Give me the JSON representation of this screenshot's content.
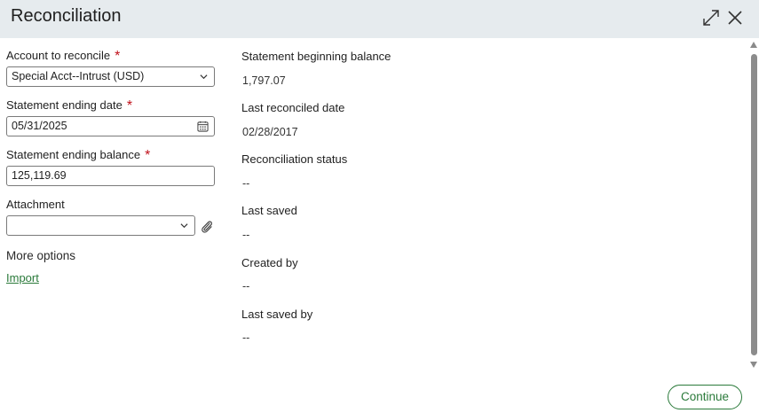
{
  "dialog": {
    "title": "Reconciliation",
    "icons": {
      "expand": "expand-icon",
      "close": "close-icon"
    }
  },
  "form": {
    "account": {
      "label": "Account to reconcile",
      "required_mark": "*",
      "value": "Special Acct--Intrust (USD)"
    },
    "end_date": {
      "label": "Statement ending date",
      "required_mark": "*",
      "value": "05/31/2025"
    },
    "end_balance": {
      "label": "Statement ending balance",
      "required_mark": "*",
      "value": "125,119.69"
    },
    "attachment": {
      "label": "Attachment",
      "value": ""
    },
    "more_options": "More options",
    "import_link": "Import"
  },
  "summary": [
    {
      "label": "Statement beginning balance",
      "value": "1,797.07"
    },
    {
      "label": "Last reconciled date",
      "value": "02/28/2017"
    },
    {
      "label": "Reconciliation status",
      "value": "--"
    },
    {
      "label": "Last saved",
      "value": "--"
    },
    {
      "label": "Created by",
      "value": "--"
    },
    {
      "label": "Last saved by",
      "value": "--"
    }
  ],
  "footer": {
    "continue_label": "Continue"
  },
  "colors": {
    "accent": "#2a7a3a",
    "required": "#c0101a",
    "header_bg": "#e6ebee"
  }
}
